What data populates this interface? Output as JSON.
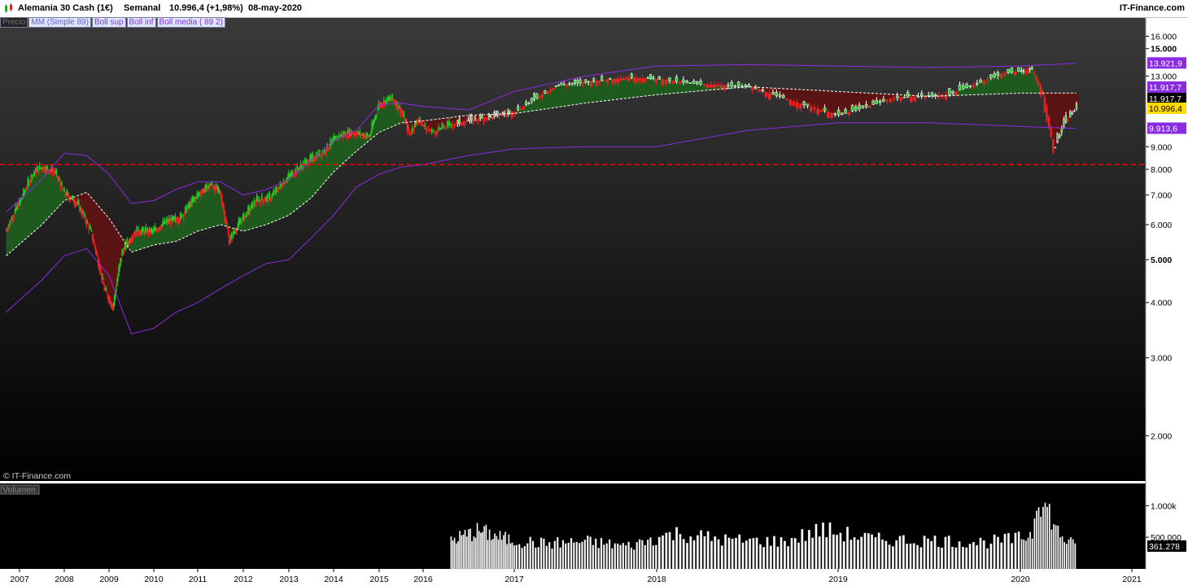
{
  "header": {
    "instrument": "Alemania 30 Cash (1€)",
    "period": "Semanal",
    "price_change": "10.996,4 (+1,98%)",
    "date": "08-may-2020",
    "brand": "IT-Finance.com"
  },
  "legend": {
    "items": [
      "Precio",
      "MM (Simple 89)",
      "Boll sup",
      "Boll inf",
      "Boll media ( 89 2)"
    ]
  },
  "watermark": "© IT-Finance.com",
  "volume_label": "Volumen",
  "price_labels": {
    "boll_sup": "13.921,9",
    "boll_media": "11.917,7",
    "mm": "11.917,7",
    "last": "10.996,4",
    "boll_inf": "9.913,6"
  },
  "volume_last": "361.278",
  "colors": {
    "up": "#22cc22",
    "down": "#ee2222",
    "boll": "#8a2be2",
    "fill_up": "#1e5a1e",
    "fill_down": "#5a1414",
    "support": "#ff0000",
    "last_tag": "#ffdd00"
  },
  "chart_data": [
    {
      "type": "line",
      "title": "Alemania 30 Cash (1€)",
      "y_ticks": [
        2000,
        3000,
        4000,
        5000,
        6000,
        7000,
        8000,
        9000,
        13000,
        15000,
        16000
      ],
      "y_tick_labels": [
        "2.000",
        "3.000",
        "4.000",
        "5.000",
        "6.000",
        "7.000",
        "8.000",
        "9.000",
        "13.000",
        "15.000",
        "16.000"
      ],
      "y_scale": "log",
      "ylim": [
        1580,
        17600
      ],
      "x_ticks": [
        "2007",
        "2008",
        "2009",
        "2010",
        "2011",
        "2012",
        "2013",
        "2014",
        "2015",
        "2016",
        "2017",
        "2018",
        "2019",
        "2020",
        "2021"
      ],
      "support_level": 8200,
      "series": [
        {
          "name": "Precio",
          "x": [
            2006.7,
            2007.0,
            2007.3,
            2007.5,
            2007.8,
            2008.0,
            2008.3,
            2008.6,
            2008.9,
            2009.1,
            2009.3,
            2009.6,
            2010.0,
            2010.3,
            2010.6,
            2011.0,
            2011.3,
            2011.5,
            2011.7,
            2011.9,
            2012.3,
            2012.6,
            2013.0,
            2013.4,
            2013.8,
            2014.1,
            2014.4,
            2014.8,
            2015.0,
            2015.3,
            2015.5,
            2015.7,
            2015.9,
            2016.1,
            2016.3,
            2016.5,
            2016.8,
            2017.0,
            2017.3,
            2017.5,
            2017.8,
            2018.0,
            2018.2,
            2018.5,
            2018.8,
            2019.0,
            2019.3,
            2019.6,
            2019.9,
            2020.1,
            2020.2,
            2020.3,
            2020.4,
            2020.5
          ],
          "values": [
            5800,
            6700,
            7800,
            8100,
            7900,
            7100,
            6700,
            5800,
            4300,
            3900,
            5200,
            5800,
            5800,
            6100,
            6200,
            7000,
            7400,
            7100,
            5500,
            6000,
            6800,
            6900,
            7700,
            8300,
            8800,
            9500,
            9700,
            9500,
            11200,
            11600,
            10900,
            9600,
            10400,
            9700,
            10100,
            10300,
            10600,
            10800,
            12400,
            12600,
            12900,
            12800,
            12500,
            12300,
            11200,
            10600,
            11600,
            11800,
            13200,
            13500,
            11900,
            8900,
            10200,
            11000
          ]
        },
        {
          "name": "Boll sup",
          "x": [
            2006.7,
            2007.5,
            2008.0,
            2008.5,
            2009.0,
            2009.5,
            2010.0,
            2010.5,
            2011.0,
            2011.5,
            2012.0,
            2012.5,
            2013.0,
            2013.5,
            2014.0,
            2014.5,
            2015.0,
            2015.5,
            2016.0,
            2016.5,
            2017.0,
            2017.5,
            2018.0,
            2018.5,
            2019.0,
            2019.5,
            2020.0,
            2020.5
          ],
          "values": [
            6400,
            7600,
            8700,
            8600,
            7800,
            6700,
            6800,
            7200,
            7500,
            7500,
            7000,
            7200,
            7600,
            8400,
            9300,
            9800,
            11200,
            11300,
            11100,
            10900,
            12000,
            13000,
            13700,
            13800,
            13700,
            13600,
            13700,
            13900
          ]
        },
        {
          "name": "Boll inf",
          "x": [
            2006.7,
            2007.5,
            2008.0,
            2008.5,
            2009.0,
            2009.5,
            2010.0,
            2010.5,
            2011.0,
            2011.5,
            2012.0,
            2012.5,
            2013.0,
            2013.5,
            2014.0,
            2014.5,
            2015.0,
            2015.5,
            2016.0,
            2016.5,
            2017.0,
            2017.5,
            2018.0,
            2018.5,
            2019.0,
            2019.5,
            2020.0,
            2020.5
          ],
          "values": [
            3800,
            4500,
            5100,
            5300,
            4600,
            3400,
            3500,
            3800,
            4000,
            4300,
            4600,
            4900,
            5000,
            5600,
            6300,
            7300,
            7800,
            8100,
            8200,
            8600,
            8900,
            9000,
            9000,
            9800,
            10200,
            10200,
            10000,
            9900
          ]
        },
        {
          "name": "MM (Simple 89)",
          "x": [
            2006.7,
            2007.5,
            2008.0,
            2008.5,
            2009.0,
            2009.5,
            2010.0,
            2010.5,
            2011.0,
            2011.5,
            2012.0,
            2012.5,
            2013.0,
            2013.5,
            2014.0,
            2014.5,
            2015.0,
            2015.5,
            2016.0,
            2016.5,
            2017.0,
            2017.5,
            2018.0,
            2018.5,
            2019.0,
            2019.5,
            2020.0,
            2020.5
          ],
          "values": [
            5100,
            6000,
            6800,
            7100,
            6200,
            5200,
            5400,
            5500,
            5800,
            6000,
            5800,
            6000,
            6300,
            6900,
            7900,
            8800,
            9700,
            10200,
            10300,
            10600,
            10700,
            11300,
            11800,
            12300,
            12000,
            11700,
            11900,
            11900
          ]
        }
      ]
    },
    {
      "type": "bar",
      "title": "Volumen",
      "y_ticks": [
        500000,
        1000000
      ],
      "y_tick_labels": [
        "500.000",
        "1.000k"
      ],
      "x": [
        2016.3,
        2016.6,
        2016.9,
        2017.2,
        2017.5,
        2017.8,
        2018.1,
        2018.4,
        2018.7,
        2018.9,
        2019.2,
        2019.5,
        2019.8,
        2020.0,
        2020.1,
        2020.15,
        2020.2,
        2020.25,
        2020.3,
        2020.4,
        2020.5
      ],
      "values": [
        450000,
        600000,
        470000,
        400000,
        430000,
        360000,
        560000,
        450000,
        430000,
        620000,
        460000,
        450000,
        420000,
        480000,
        560000,
        1220000,
        1000000,
        920000,
        660000,
        450000,
        361278
      ]
    }
  ]
}
